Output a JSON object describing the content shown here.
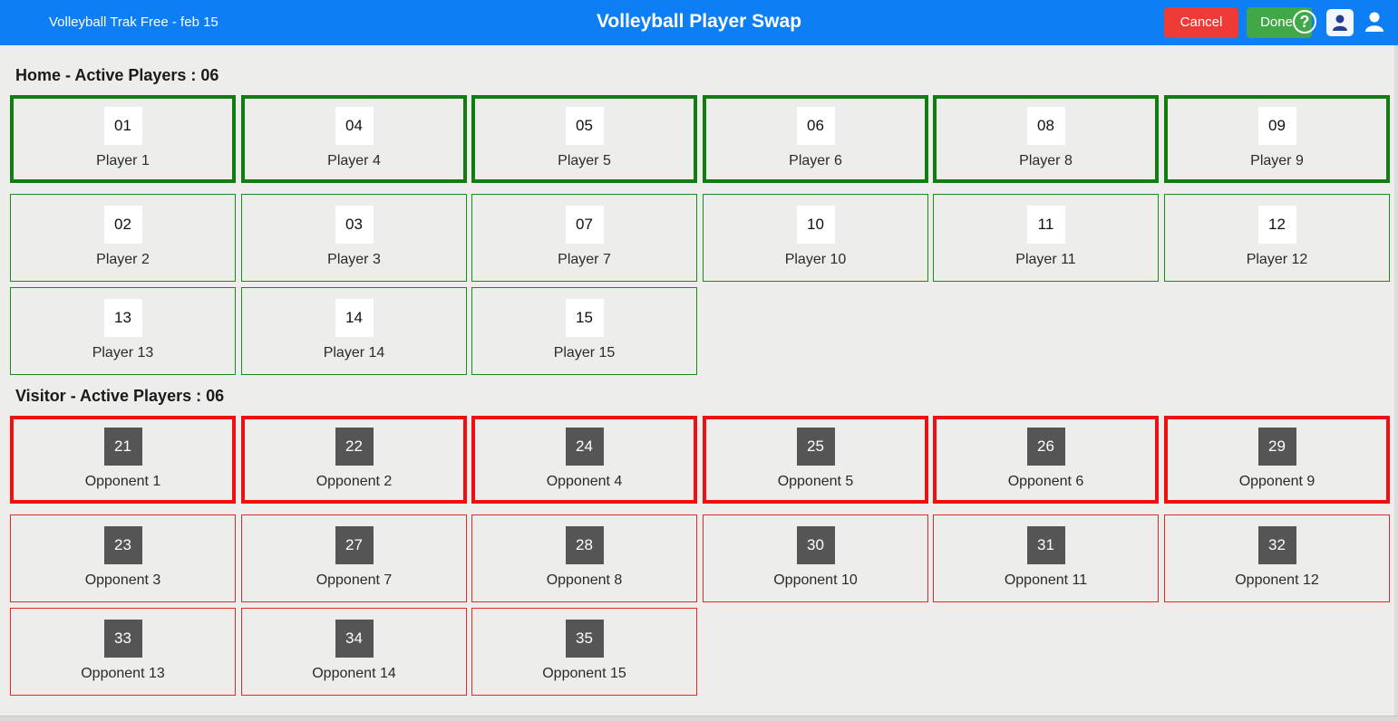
{
  "header": {
    "app_title": "Volleyball Trak Free - feb 15",
    "page_title": "Volleyball Player Swap",
    "cancel_label": "Cancel",
    "done_label": "Done",
    "help_glyph": "?",
    "icons": [
      "help-circle-icon",
      "contact-card-icon",
      "user-profile-icon"
    ],
    "colors": {
      "bar": "#0d7ef4",
      "cancel": "#ef3b35",
      "done": "#41a847"
    }
  },
  "home": {
    "heading": "Home - Active Players : 06",
    "color": "#0f7d0f",
    "players": [
      {
        "number": "01",
        "name": "Player 1",
        "active": true
      },
      {
        "number": "04",
        "name": "Player 4",
        "active": true
      },
      {
        "number": "05",
        "name": "Player 5",
        "active": true
      },
      {
        "number": "06",
        "name": "Player 6",
        "active": true
      },
      {
        "number": "08",
        "name": "Player 8",
        "active": true
      },
      {
        "number": "09",
        "name": "Player 9",
        "active": true
      },
      {
        "number": "02",
        "name": "Player 2",
        "active": false
      },
      {
        "number": "03",
        "name": "Player 3",
        "active": false
      },
      {
        "number": "07",
        "name": "Player 7",
        "active": false
      },
      {
        "number": "10",
        "name": "Player 10",
        "active": false
      },
      {
        "number": "11",
        "name": "Player 11",
        "active": false
      },
      {
        "number": "12",
        "name": "Player 12",
        "active": false
      },
      {
        "number": "13",
        "name": "Player 13",
        "active": false
      },
      {
        "number": "14",
        "name": "Player 14",
        "active": false
      },
      {
        "number": "15",
        "name": "Player 15",
        "active": false
      }
    ]
  },
  "visitor": {
    "heading": "Visitor - Active Players : 06",
    "color": "#ee1111",
    "players": [
      {
        "number": "21",
        "name": "Opponent 1",
        "active": true
      },
      {
        "number": "22",
        "name": "Opponent 2",
        "active": true
      },
      {
        "number": "24",
        "name": "Opponent 4",
        "active": true
      },
      {
        "number": "25",
        "name": "Opponent 5",
        "active": true
      },
      {
        "number": "26",
        "name": "Opponent 6",
        "active": true
      },
      {
        "number": "29",
        "name": "Opponent 9",
        "active": true
      },
      {
        "number": "23",
        "name": "Opponent 3",
        "active": false
      },
      {
        "number": "27",
        "name": "Opponent 7",
        "active": false
      },
      {
        "number": "28",
        "name": "Opponent 8",
        "active": false
      },
      {
        "number": "30",
        "name": "Opponent 10",
        "active": false
      },
      {
        "number": "31",
        "name": "Opponent 11",
        "active": false
      },
      {
        "number": "32",
        "name": "Opponent 12",
        "active": false
      },
      {
        "number": "33",
        "name": "Opponent 13",
        "active": false
      },
      {
        "number": "34",
        "name": "Opponent 14",
        "active": false
      },
      {
        "number": "35",
        "name": "Opponent 15",
        "active": false
      }
    ]
  }
}
